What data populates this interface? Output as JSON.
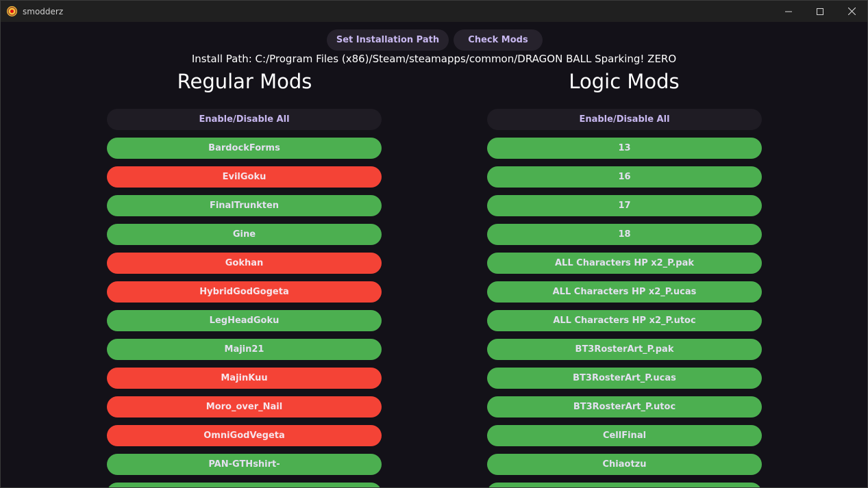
{
  "window": {
    "title": "smodderz",
    "controls": {
      "minimize_icon": "minimize-icon",
      "maximize_icon": "maximize-icon",
      "close_icon": "close-icon"
    }
  },
  "toolbar": {
    "set_path_label": "Set Installation Path",
    "check_mods_label": "Check Mods"
  },
  "install_path_text": "Install Path: C:/Program Files (x86)/Steam/steamapps/common/DRAGON BALL Sparking! ZERO",
  "colors": {
    "enabled": "#4caf50",
    "disabled": "#f44336",
    "background": "#131118",
    "accent_text": "#c8b8f0"
  },
  "regular_mods": {
    "title": "Regular Mods",
    "toggle_all_label": "Enable/Disable All",
    "items": [
      {
        "label": "BardockForms",
        "enabled": true
      },
      {
        "label": "EvilGoku",
        "enabled": false
      },
      {
        "label": "FinalTrunkten",
        "enabled": true
      },
      {
        "label": "Gine",
        "enabled": true
      },
      {
        "label": "Gokhan",
        "enabled": false
      },
      {
        "label": "HybridGodGogeta",
        "enabled": false
      },
      {
        "label": "LegHeadGoku",
        "enabled": true
      },
      {
        "label": "Majin21",
        "enabled": true
      },
      {
        "label": "MajinKuu",
        "enabled": false
      },
      {
        "label": "Moro_over_Nail",
        "enabled": false
      },
      {
        "label": "OmniGodVegeta",
        "enabled": false
      },
      {
        "label": "PAN-GTHshirt-",
        "enabled": true
      },
      {
        "label": "",
        "enabled": true
      }
    ]
  },
  "logic_mods": {
    "title": "Logic Mods",
    "toggle_all_label": "Enable/Disable All",
    "items": [
      {
        "label": "13",
        "enabled": true
      },
      {
        "label": "16",
        "enabled": true
      },
      {
        "label": "17",
        "enabled": true
      },
      {
        "label": "18",
        "enabled": true
      },
      {
        "label": "ALL Characters HP x2_P.pak",
        "enabled": true
      },
      {
        "label": "ALL Characters HP x2_P.ucas",
        "enabled": true
      },
      {
        "label": "ALL Characters HP x2_P.utoc",
        "enabled": true
      },
      {
        "label": "BT3RosterArt_P.pak",
        "enabled": true
      },
      {
        "label": "BT3RosterArt_P.ucas",
        "enabled": true
      },
      {
        "label": "BT3RosterArt_P.utoc",
        "enabled": true
      },
      {
        "label": "CellFinal",
        "enabled": true
      },
      {
        "label": "Chiaotzu",
        "enabled": true
      },
      {
        "label": "",
        "enabled": true
      }
    ]
  }
}
